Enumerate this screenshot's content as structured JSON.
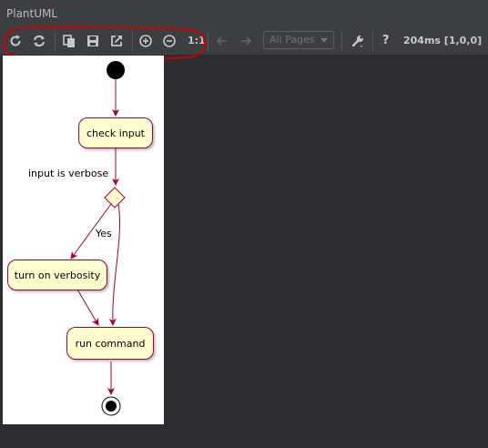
{
  "window": {
    "title": "PlantUML"
  },
  "toolbar": {
    "buttons": [
      {
        "icon": "refresh-icon",
        "label": "Refresh"
      },
      {
        "icon": "sync-icon",
        "label": "Sync"
      },
      {
        "icon": "copy-icon",
        "label": "Copy"
      },
      {
        "icon": "save-icon",
        "label": "Save"
      },
      {
        "icon": "external-icon",
        "label": "Open external"
      },
      {
        "icon": "zoom-in-icon",
        "label": "Zoom in"
      },
      {
        "icon": "zoom-out-icon",
        "label": "Zoom out"
      }
    ],
    "actual_size_label": "1:1",
    "page_select_value": "All Pages",
    "help_label": "?",
    "status_text": "204ms [1,0,0]"
  },
  "diagram": {
    "guard_label": "input is verbose",
    "branch_label": "Yes",
    "nodes": {
      "check_input": "check input",
      "turn_on_verbosity": "turn on verbosity",
      "run_command": "run command"
    },
    "colors": {
      "node_fill": "#fefece",
      "node_border": "#a80036",
      "arrow": "#a80036",
      "annotation": "#cc0000"
    }
  }
}
